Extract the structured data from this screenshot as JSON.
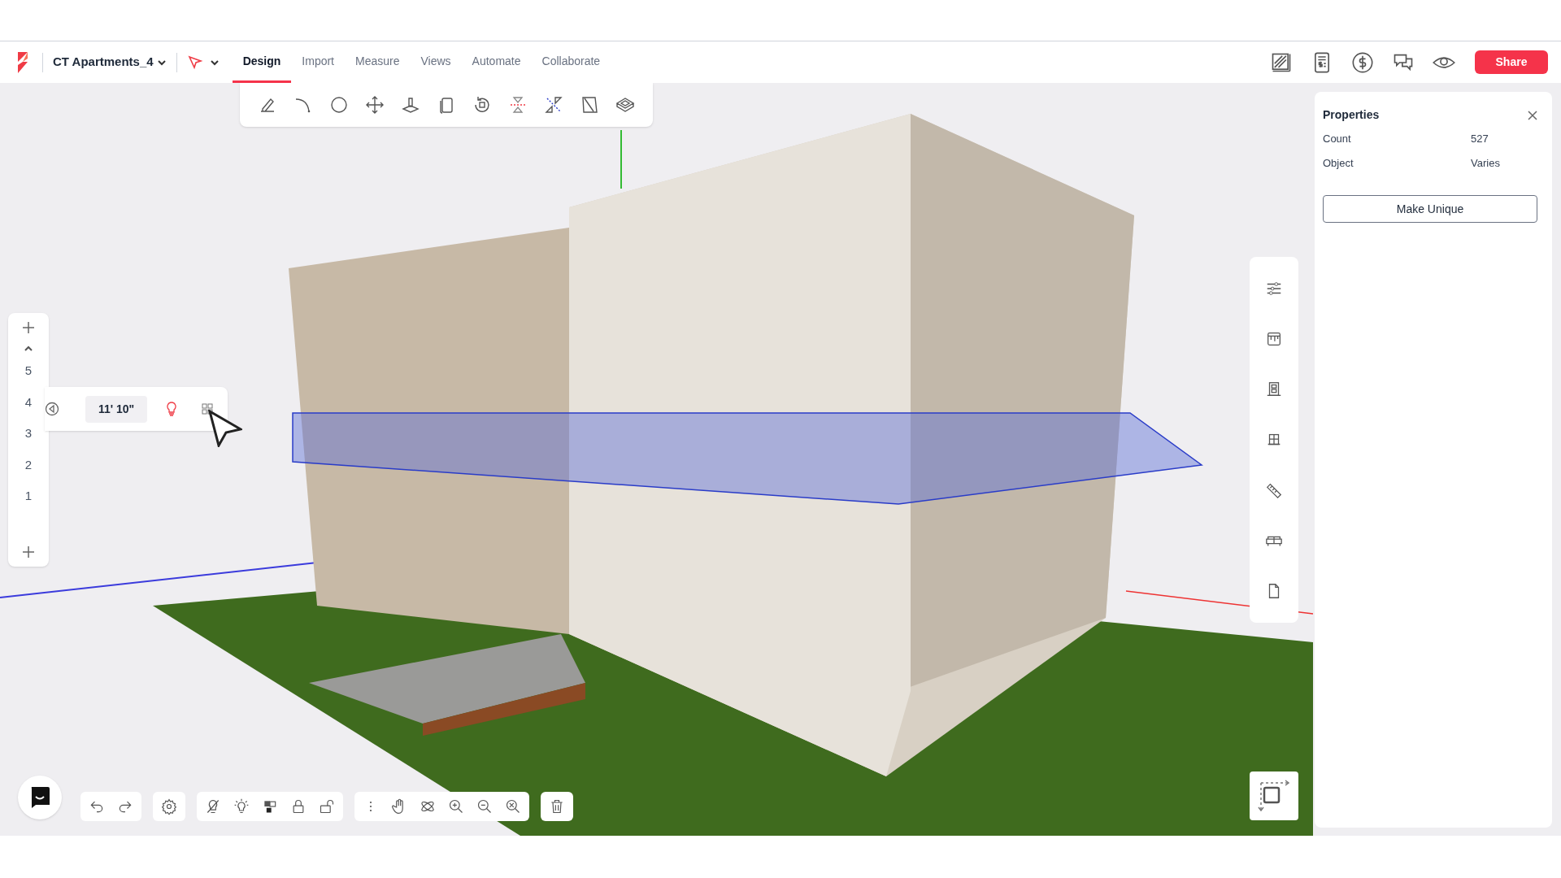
{
  "header": {
    "project_title": "CT Apartments_4",
    "tabs": [
      {
        "label": "Design",
        "selected": true
      },
      {
        "label": "Import",
        "selected": false
      },
      {
        "label": "Measure",
        "selected": false
      },
      {
        "label": "Views",
        "selected": false
      },
      {
        "label": "Automate",
        "selected": false
      },
      {
        "label": "Collaborate",
        "selected": false
      }
    ],
    "share_button": "Share"
  },
  "floors": {
    "items": [
      "5",
      "4",
      "3",
      "2",
      "1"
    ],
    "popup": {
      "height": "11' 10\""
    }
  },
  "properties": {
    "title": "Properties",
    "rows": [
      {
        "label": "Count",
        "value": "527"
      },
      {
        "label": "Object",
        "value": "Varies"
      }
    ],
    "button": "Make Unique"
  }
}
